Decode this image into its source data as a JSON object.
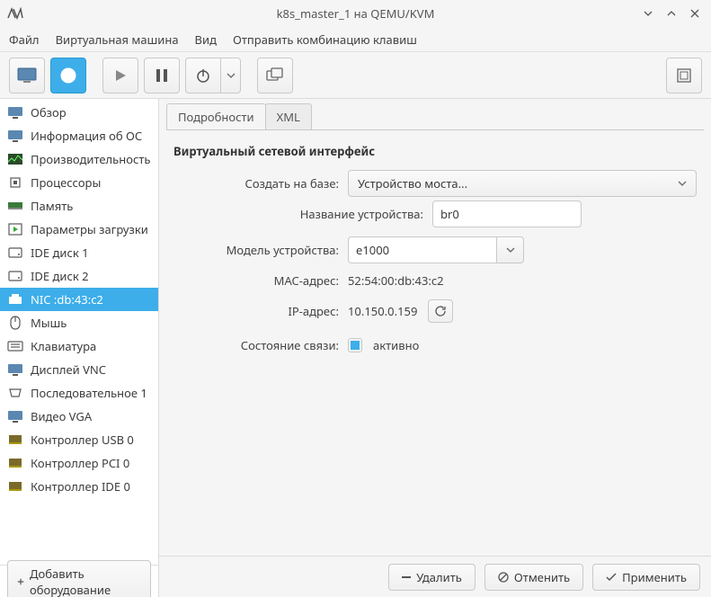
{
  "window": {
    "title": "k8s_master_1 на QEMU/KVM"
  },
  "menu": {
    "file": "Файл",
    "vm": "Виртуальная машина",
    "view": "Вид",
    "sendkey": "Отправить комбинацию клавиш"
  },
  "sidebar": {
    "items": [
      {
        "label": "Обзор",
        "icon": "monitor"
      },
      {
        "label": "Информация об ОС",
        "icon": "monitor"
      },
      {
        "label": "Производительность",
        "icon": "perf"
      },
      {
        "label": "Процессоры",
        "icon": "cpu"
      },
      {
        "label": "Память",
        "icon": "mem"
      },
      {
        "label": "Параметры загрузки",
        "icon": "boot"
      },
      {
        "label": "IDE диск 1",
        "icon": "disk"
      },
      {
        "label": "IDE диск 2",
        "icon": "disk"
      },
      {
        "label": "NIC :db:43:c2",
        "icon": "nic",
        "selected": true
      },
      {
        "label": "Мышь",
        "icon": "mouse"
      },
      {
        "label": "Клавиатура",
        "icon": "keyboard"
      },
      {
        "label": "Дисплей VNC",
        "icon": "monitor"
      },
      {
        "label": "Последовательное 1",
        "icon": "serial"
      },
      {
        "label": "Видео VGA",
        "icon": "monitor"
      },
      {
        "label": "Контроллер USB 0",
        "icon": "ctrl"
      },
      {
        "label": "Контроллер PCI 0",
        "icon": "ctrl"
      },
      {
        "label": "Контроллер IDE 0",
        "icon": "ctrl"
      }
    ],
    "add": "Добавить оборудование"
  },
  "tabs": {
    "details": "Подробности",
    "xml": "XML"
  },
  "nic": {
    "heading": "Виртуальный сетевой интерфейс",
    "base_label": "Создать на базе:",
    "base_value": "Устройство моста...",
    "devname_label": "Название устройства:",
    "devname_value": "br0",
    "model_label": "Модель устройства:",
    "model_value": "e1000",
    "mac_label": "MAC-адрес:",
    "mac_value": "52:54:00:db:43:c2",
    "ip_label": "IP-адрес:",
    "ip_value": "10.150.0.159",
    "link_label": "Состояние связи:",
    "link_value": "активно"
  },
  "buttons": {
    "delete": "Удалить",
    "cancel": "Отменить",
    "apply": "Применить"
  }
}
